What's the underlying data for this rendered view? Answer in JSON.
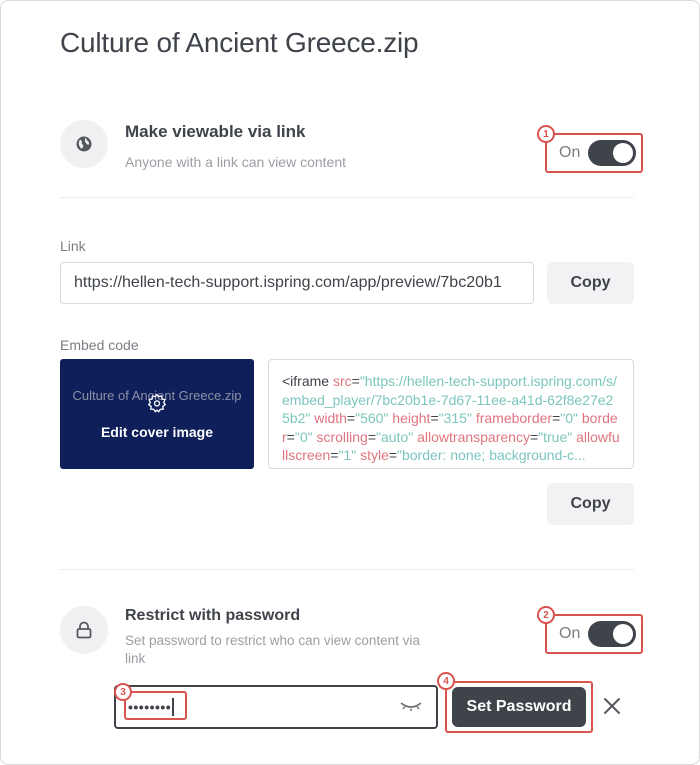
{
  "title": "Culture of Ancient Greece.zip",
  "link_section": {
    "icon": "globe-icon",
    "title": "Make viewable via link",
    "subtitle": "Anyone with a link can view content",
    "toggle_label": "On",
    "toggle_on": true
  },
  "link": {
    "label": "Link",
    "value": "https://hellen-tech-support.ispring.com/app/preview/7bc20b1",
    "copy_label": "Copy"
  },
  "embed": {
    "label": "Embed code",
    "cover_title": "Culture of Ancient Greece.zip",
    "cover_edit_label": "Edit cover image",
    "code_tokens": [
      {
        "t": "tag",
        "v": "<iframe "
      },
      {
        "t": "attr",
        "v": "src"
      },
      {
        "t": "eq",
        "v": "="
      },
      {
        "t": "val",
        "v": "\"https://hellen-tech-support.ispring.com/s/embed_player/7bc20b1e-7d67-11ee-a41d-62f8e27e25b2\" "
      },
      {
        "t": "attr",
        "v": "width"
      },
      {
        "t": "eq",
        "v": "="
      },
      {
        "t": "val",
        "v": "\"560\" "
      },
      {
        "t": "attr",
        "v": "height"
      },
      {
        "t": "eq",
        "v": "="
      },
      {
        "t": "val",
        "v": "\"315\" "
      },
      {
        "t": "attr",
        "v": "frameborder"
      },
      {
        "t": "eq",
        "v": "="
      },
      {
        "t": "val",
        "v": "\"0\" "
      },
      {
        "t": "attr",
        "v": "border"
      },
      {
        "t": "eq",
        "v": "="
      },
      {
        "t": "val",
        "v": "\"0\" "
      },
      {
        "t": "attr",
        "v": "scrolling"
      },
      {
        "t": "eq",
        "v": "="
      },
      {
        "t": "val",
        "v": "\"auto\" "
      },
      {
        "t": "attr",
        "v": "allowtransparency"
      },
      {
        "t": "eq",
        "v": "="
      },
      {
        "t": "val",
        "v": "\"true\" "
      },
      {
        "t": "attr",
        "v": "allowfullscreen"
      },
      {
        "t": "eq",
        "v": "="
      },
      {
        "t": "val",
        "v": "\"1\" "
      },
      {
        "t": "attr",
        "v": "style"
      },
      {
        "t": "eq",
        "v": "="
      },
      {
        "t": "val",
        "v": "\"border: none; background-c..."
      }
    ],
    "copy_label": "Copy"
  },
  "password_section": {
    "icon": "lock-icon",
    "title": "Restrict with password",
    "subtitle": "Set password to restrict who can view content via link",
    "toggle_label": "On",
    "toggle_on": true,
    "password_value": "••••••••",
    "set_label": "Set Password"
  },
  "annotations": [
    "1",
    "2",
    "3",
    "4"
  ],
  "colors": {
    "accent_dark": "#3f434a",
    "annotation": "#d9534f",
    "cover_bg": "#0e1f5a",
    "code_attr": "#e0747f",
    "code_value": "#7cc6bd"
  }
}
